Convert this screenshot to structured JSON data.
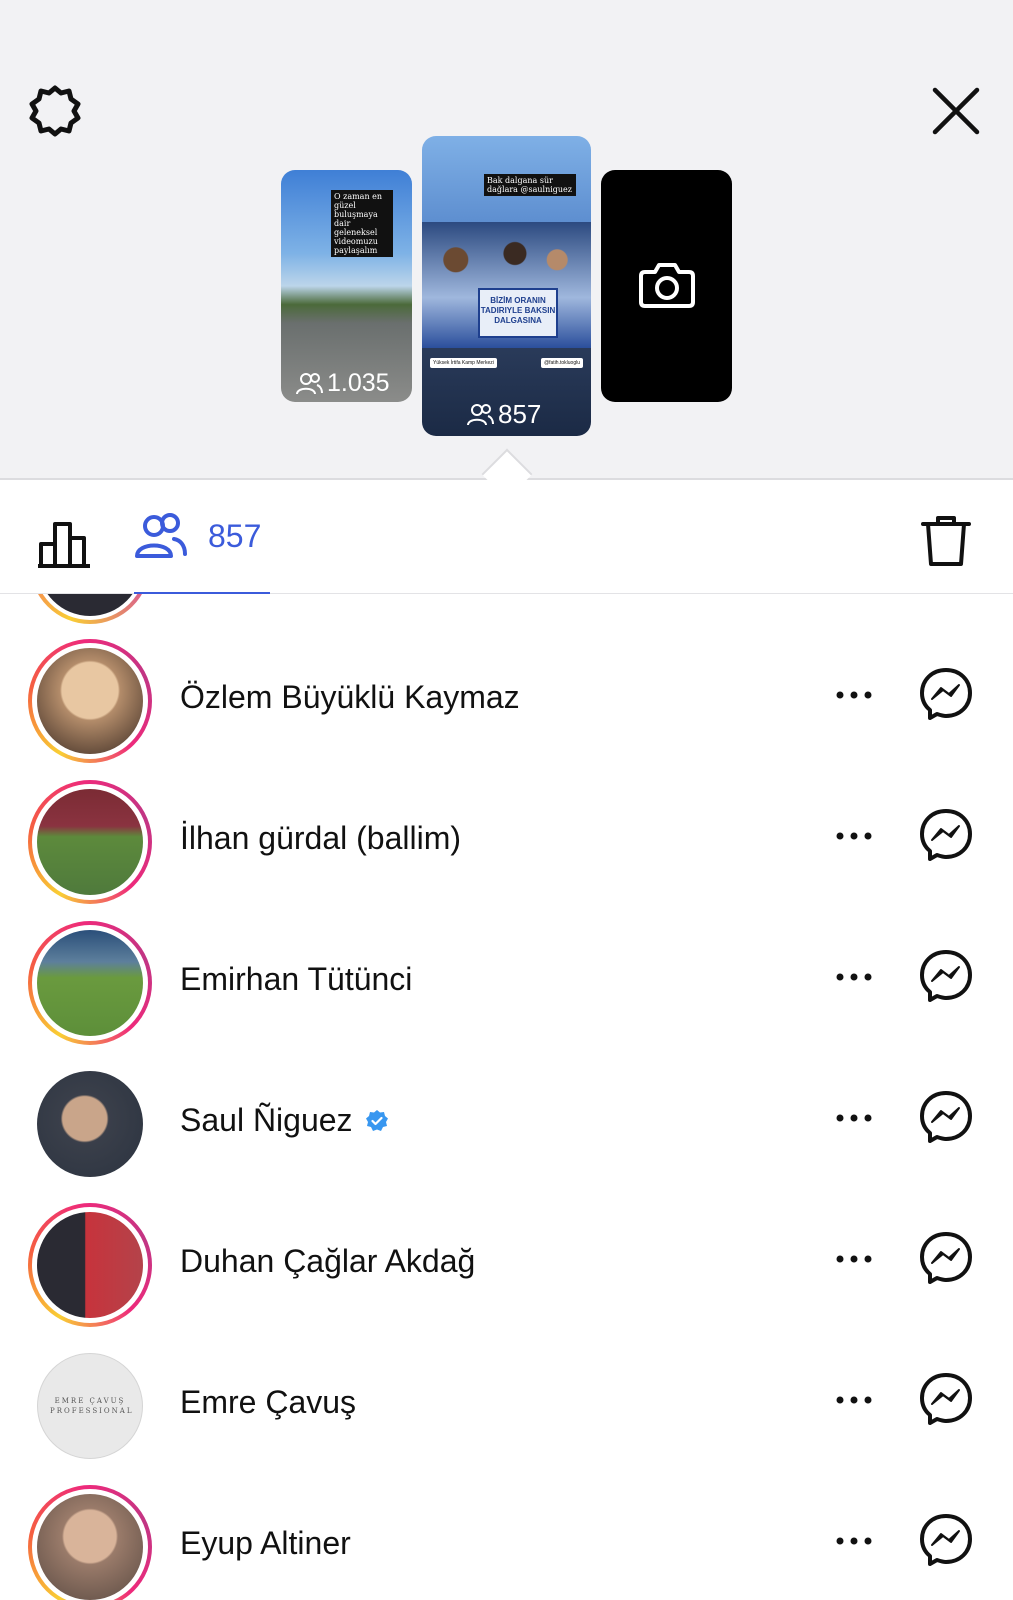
{
  "header": {
    "settings_icon": "gear-icon",
    "close_icon": "close-icon"
  },
  "stories": [
    {
      "caption": "O zaman en güzel buluşmaya dair geleneksel videomuzu paylaşalım",
      "views": "1.035"
    },
    {
      "caption": "Bak dalgana sür dağlara @saulniguez",
      "banner_text": "BİZİM ORANIN TADIRIYLE BAKSIN DALGASINA",
      "tag_left": "Yüksek İrtifa Kamp Merkezi",
      "tag_right": "@fatih.tokluoglu",
      "views": "857"
    },
    {
      "type": "camera",
      "icon": "camera-icon"
    }
  ],
  "tabs": {
    "stats_icon": "bar-chart-icon",
    "viewers_icon": "people-icon",
    "viewers_count": "857",
    "delete_icon": "trash-icon"
  },
  "colors": {
    "accent": "#3b5bdb",
    "verified": "#3897f0",
    "story_ring_start": "#f9ce34",
    "story_ring_end": "#ee2a7b"
  },
  "viewers": [
    {
      "name": "Özlem Büyüklü Kaymaz",
      "ring": true,
      "verified": false,
      "photo_color": "#b38c6a"
    },
    {
      "name": "İlhan gürdal (ballim)",
      "ring": true,
      "verified": false,
      "photo_color": "#4f7a3c"
    },
    {
      "name": "Emirhan Tütünci",
      "ring": true,
      "verified": false,
      "photo_color": "#5d8f3a"
    },
    {
      "name": "Saul Ñiguez",
      "ring": false,
      "verified": true,
      "photo_color": "#2b3340"
    },
    {
      "name": "Duhan Çağlar Akdağ",
      "ring": true,
      "verified": false,
      "photo_color": "#b4434a"
    },
    {
      "name": "Emre Çavuş",
      "ring": false,
      "verified": false,
      "photo_color": "#e8e8e8",
      "logo_text": "EMRE ÇAVUŞ PROFESSIONAL"
    },
    {
      "name": "Eyup Altiner",
      "ring": true,
      "verified": false,
      "photo_color": "#9a7b6a"
    }
  ]
}
